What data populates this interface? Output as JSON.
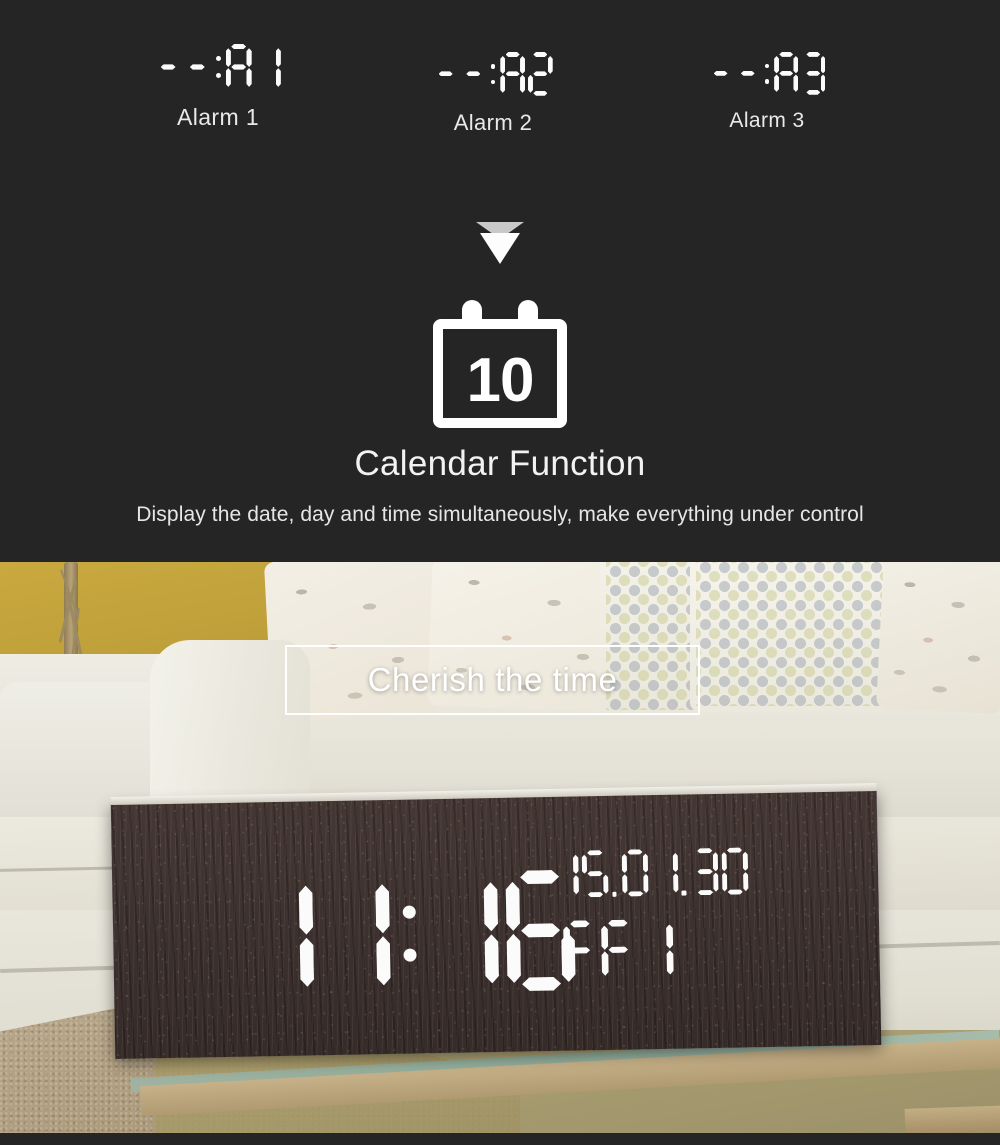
{
  "colors": {
    "panel_bg": "#252525",
    "led_white": "#fbfbfb",
    "accent_text": "#f2f2f2",
    "wood_dark": "#3e3230",
    "wall_yellow": "#c9a93f",
    "sofa_cream": "#eceadf"
  },
  "alarms": {
    "items": [
      {
        "display": "--:A1",
        "label": "Alarm 1"
      },
      {
        "display": "--:A2",
        "label": "Alarm 2"
      },
      {
        "display": "--:A3",
        "label": "Alarm 3"
      }
    ]
  },
  "arrow": {
    "icon": "triangle-down-icon"
  },
  "calendar": {
    "icon": "calendar-icon",
    "day_number": "10",
    "title": "Calendar Function",
    "subtitle": "Display the date, day and time simultaneously, make everything under control"
  },
  "banner": {
    "text": "Cherish the time"
  },
  "clock": {
    "time": "11:16",
    "date": "15.01.30",
    "weekday": "FRI"
  }
}
